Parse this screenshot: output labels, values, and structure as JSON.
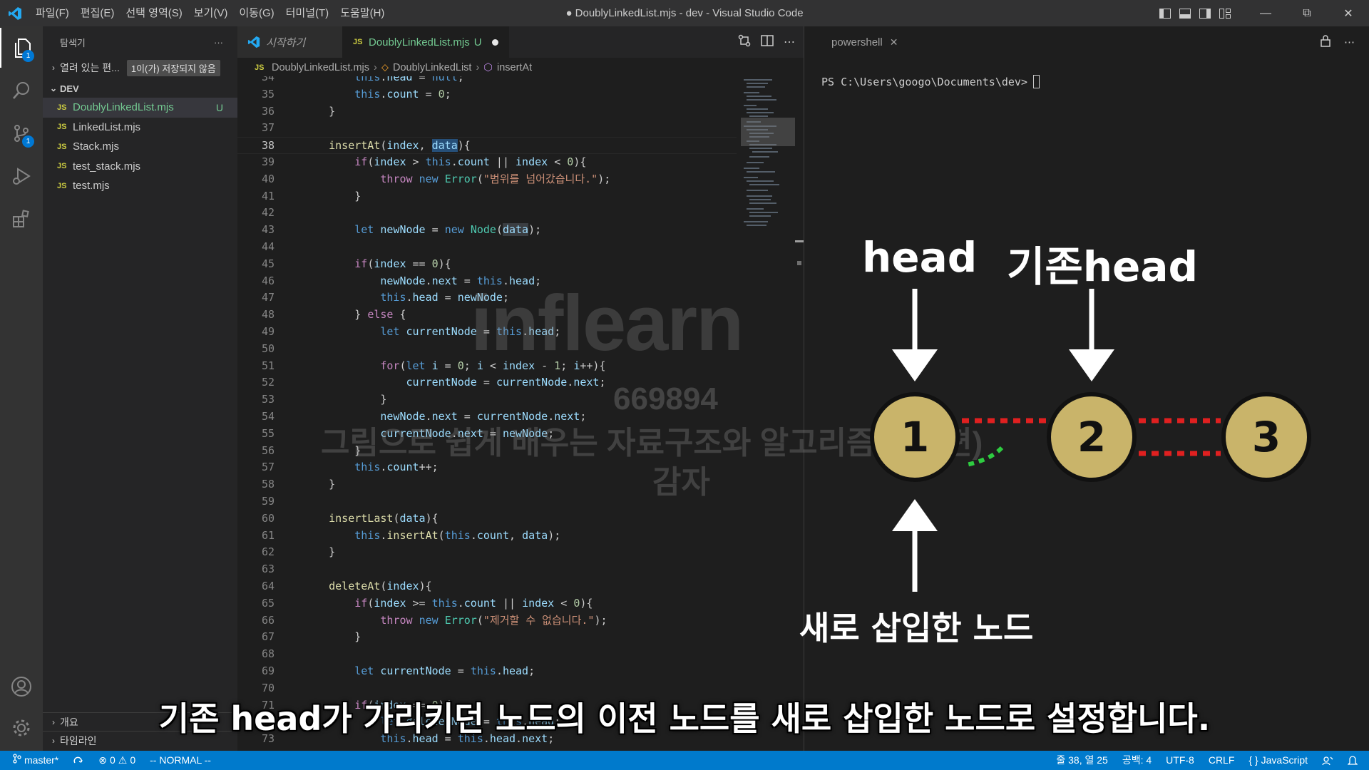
{
  "titlebar": {
    "menus": [
      "파일(F)",
      "편집(E)",
      "선택 영역(S)",
      "보기(V)",
      "이동(G)",
      "터미널(T)",
      "도움말(H)"
    ],
    "title": "● DoublyLinkedList.mjs - dev - Visual Studio Code"
  },
  "activity": {
    "explorer_badge": "1",
    "scm_badge": "1"
  },
  "sidebar": {
    "header": "탐색기",
    "more": "···",
    "open_editors": "열려 있는 편...",
    "unsaved_badge": "1이(가) 저장되지 않음",
    "folder": "DEV",
    "files": [
      {
        "tag": "JS",
        "name": "DoublyLinkedList.mjs",
        "status": "U"
      },
      {
        "tag": "JS",
        "name": "LinkedList.mjs",
        "status": ""
      },
      {
        "tag": "JS",
        "name": "Stack.mjs",
        "status": ""
      },
      {
        "tag": "JS",
        "name": "test_stack.mjs",
        "status": ""
      },
      {
        "tag": "JS",
        "name": "test.mjs",
        "status": ""
      }
    ],
    "outline": "개요",
    "timeline": "타임라인"
  },
  "editor": {
    "tabs": {
      "welcome": "시작하기",
      "file_tag": "JS",
      "file": "DoublyLinkedList.mjs",
      "file_status": "U"
    },
    "breadcrumb": {
      "file_tag": "JS",
      "file": "DoublyLinkedList.mjs",
      "class": "DoublyLinkedList",
      "method": "insertAt"
    },
    "lines": [
      {
        "n": "34",
        "html": "        <span class='k'>this</span>.<span class='v'>head</span> = <span class='k'>null</span>;"
      },
      {
        "n": "35",
        "html": "        <span class='k'>this</span>.<span class='v'>count</span> = <span class='num'>0</span>;"
      },
      {
        "n": "36",
        "html": "    }"
      },
      {
        "n": "37",
        "html": ""
      },
      {
        "n": "38",
        "html": "    <span class='f'>insertAt</span>(<span class='v'>index</span>, <span class='v hl'>data</span>){"
      },
      {
        "n": "39",
        "html": "        <span class='c'>if</span>(<span class='v'>index</span> &gt; <span class='k'>this</span>.<span class='v'>count</span> || <span class='v'>index</span> &lt; <span class='num'>0</span>){"
      },
      {
        "n": "40",
        "html": "            <span class='c'>throw</span> <span class='k'>new</span> <span class='t'>Error</span>(<span class='s'>\"범위를 넘어갔습니다.\"</span>);"
      },
      {
        "n": "41",
        "html": "        }"
      },
      {
        "n": "42",
        "html": ""
      },
      {
        "n": "43",
        "html": "        <span class='k'>let</span> <span class='v'>newNode</span> = <span class='k'>new</span> <span class='t'>Node</span>(<span class='v hl2'>data</span>);"
      },
      {
        "n": "44",
        "html": ""
      },
      {
        "n": "45",
        "html": "        <span class='c'>if</span>(<span class='v'>index</span> == <span class='num'>0</span>){"
      },
      {
        "n": "46",
        "html": "            <span class='v'>newNode</span>.<span class='v'>next</span> = <span class='k'>this</span>.<span class='v'>head</span>;"
      },
      {
        "n": "47",
        "html": "            <span class='k'>this</span>.<span class='v'>head</span> = <span class='v'>newNode</span>;"
      },
      {
        "n": "48",
        "html": "        } <span class='c'>else</span> {"
      },
      {
        "n": "49",
        "html": "            <span class='k'>let</span> <span class='v'>currentNode</span> = <span class='k'>this</span>.<span class='v'>head</span>;"
      },
      {
        "n": "50",
        "html": ""
      },
      {
        "n": "51",
        "html": "            <span class='c'>for</span>(<span class='k'>let</span> <span class='v'>i</span> = <span class='num'>0</span>; <span class='v'>i</span> &lt; <span class='v'>index</span> - <span class='num'>1</span>; <span class='v'>i</span>++){"
      },
      {
        "n": "52",
        "html": "                <span class='v'>currentNode</span> = <span class='v'>currentNode</span>.<span class='v'>next</span>;"
      },
      {
        "n": "53",
        "html": "            }"
      },
      {
        "n": "54",
        "html": "            <span class='v'>newNode</span>.<span class='v'>next</span> = <span class='v'>currentNode</span>.<span class='v'>next</span>;"
      },
      {
        "n": "55",
        "html": "            <span class='v'>currentNode</span>.<span class='v'>next</span> = <span class='v'>newNode</span>;"
      },
      {
        "n": "56",
        "html": "        }"
      },
      {
        "n": "57",
        "html": "        <span class='k'>this</span>.<span class='v'>count</span>++;"
      },
      {
        "n": "58",
        "html": "    }"
      },
      {
        "n": "59",
        "html": ""
      },
      {
        "n": "60",
        "html": "    <span class='f'>insertLast</span>(<span class='v'>data</span>){"
      },
      {
        "n": "61",
        "html": "        <span class='k'>this</span>.<span class='f'>insertAt</span>(<span class='k'>this</span>.<span class='v'>count</span>, <span class='v'>data</span>);"
      },
      {
        "n": "62",
        "html": "    }"
      },
      {
        "n": "63",
        "html": ""
      },
      {
        "n": "64",
        "html": "    <span class='f'>deleteAt</span>(<span class='v'>index</span>){"
      },
      {
        "n": "65",
        "html": "        <span class='c'>if</span>(<span class='v'>index</span> &gt;= <span class='k'>this</span>.<span class='v'>count</span> || <span class='v'>index</span> &lt; <span class='num'>0</span>){"
      },
      {
        "n": "66",
        "html": "            <span class='c'>throw</span> <span class='k'>new</span> <span class='t'>Error</span>(<span class='s'>\"제거할 수 없습니다.\"</span>);"
      },
      {
        "n": "67",
        "html": "        }"
      },
      {
        "n": "68",
        "html": ""
      },
      {
        "n": "69",
        "html": "        <span class='k'>let</span> <span class='v'>currentNode</span> = <span class='k'>this</span>.<span class='v'>head</span>;"
      },
      {
        "n": "70",
        "html": ""
      },
      {
        "n": "71",
        "html": "        <span class='c'>if</span>(<span class='v'>index</span> == <span class='num'>0</span>){"
      },
      {
        "n": "72",
        "html": "            <span class='k'>let</span> <span class='v'>deletedNode</span> = <span class='k'>this</span>.<span class='v'>head</span>;"
      },
      {
        "n": "73",
        "html": "            <span class='k'>this</span>.<span class='v'>head</span> = <span class='k'>this</span>.<span class='v'>head</span>.<span class='v'>next</span>;"
      }
    ]
  },
  "terminal": {
    "tab": "powershell",
    "prompt": "PS C:\\Users\\googo\\Documents\\dev>"
  },
  "statusbar": {
    "branch": "master*",
    "errors": "0",
    "warnings": "0",
    "mode": "-- NORMAL --",
    "position": "줄 38, 열 25",
    "spaces": "공백: 4",
    "encoding": "UTF-8",
    "eol": "CRLF",
    "language": "JavaScript"
  },
  "overlay": {
    "watermark_logo": "inflearn",
    "watermark_id": "669894",
    "watermark_course": "그림으로 쉽게 배우는 자료구조와 알고리즘(기본편)",
    "watermark_thanks": "감자",
    "label_head": "head",
    "label_old_head": "기존head",
    "label_new_node": "새로 삽입한 노드",
    "nodes": [
      "1",
      "2",
      "3"
    ],
    "subtitle": "기존 head가 가리키던 노드의 이전 노드를 새로 삽입한 노드로 설정합니다."
  },
  "colors": {
    "accent": "#007acc",
    "node_fill": "#c9b46a",
    "link_red": "#e02020",
    "link_green": "#2ecc40"
  }
}
